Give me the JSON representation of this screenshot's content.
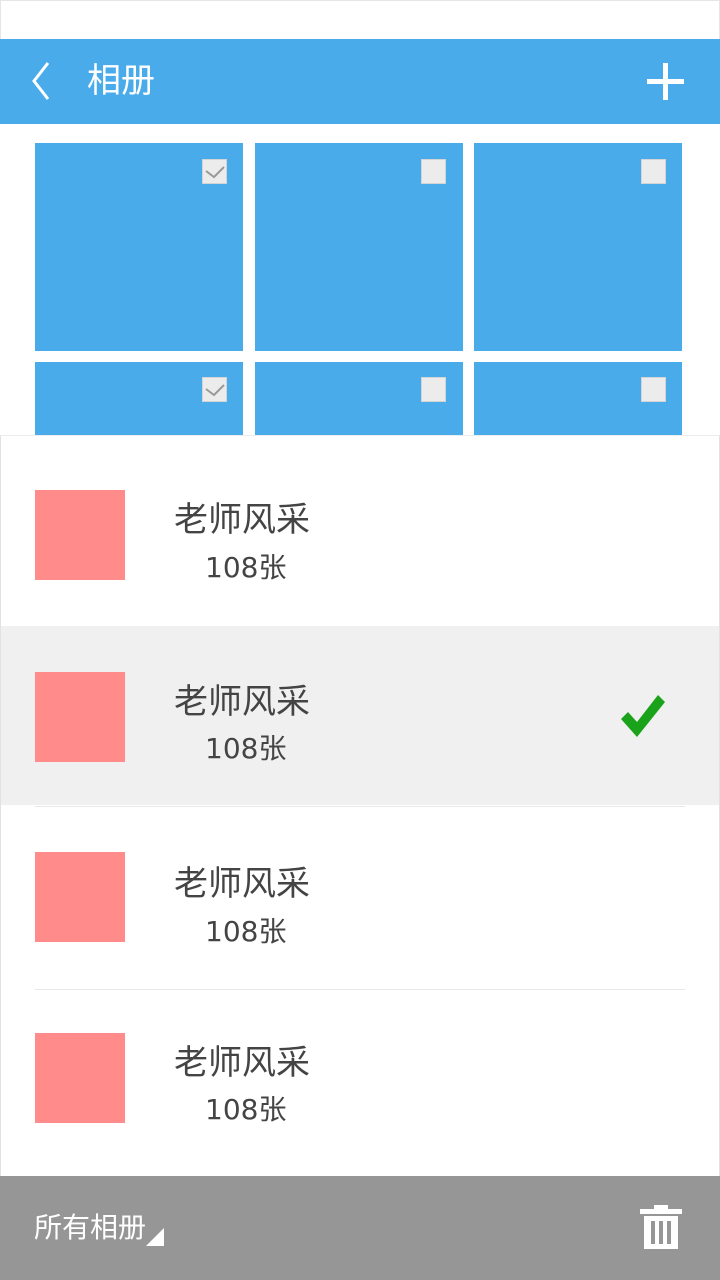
{
  "header": {
    "title": "相册",
    "back_icon": "chevron-left-icon",
    "add_icon": "plus-icon"
  },
  "photos": [
    {
      "checked": true
    },
    {
      "checked": false
    },
    {
      "checked": false
    },
    {
      "checked": true
    },
    {
      "checked": false
    },
    {
      "checked": false
    }
  ],
  "albums": [
    {
      "name": "老师风采",
      "count": "108张",
      "selected": false
    },
    {
      "name": "老师风采",
      "count": "108张",
      "selected": true
    },
    {
      "name": "老师风采",
      "count": "108张",
      "selected": false
    },
    {
      "name": "老师风采",
      "count": "108张",
      "selected": false
    }
  ],
  "footer": {
    "label": "所有相册",
    "dropdown_icon": "corner-triangle-icon",
    "trash_icon": "trash-icon"
  },
  "colors": {
    "primary": "#4aabea",
    "thumb": "#ff8b8b",
    "check_green": "#1aa21a",
    "footer_bg": "#969696",
    "selected_row": "#f0f0f0"
  }
}
